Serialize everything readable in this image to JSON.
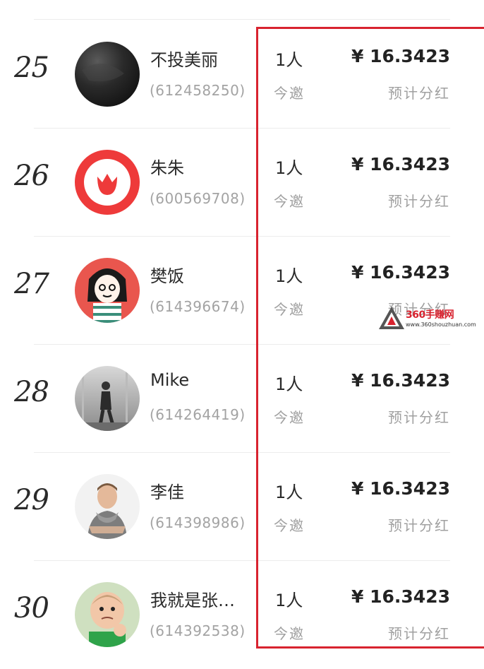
{
  "rows": [
    {
      "rank": "25",
      "name": "不投美丽",
      "uid": "(612458250)",
      "count": "1人",
      "invite_label": "今邀",
      "amount": "¥ 16.3423",
      "dividend_label": "预计分红",
      "avatar": "dark-blur-avatar"
    },
    {
      "rank": "26",
      "name": "朱朱",
      "uid": "(600569708)",
      "count": "1人",
      "invite_label": "今邀",
      "amount": "¥ 16.3423",
      "dividend_label": "预计分红",
      "avatar": "red-tulip-logo-avatar"
    },
    {
      "rank": "27",
      "name": "樊饭",
      "uid": "(614396674)",
      "count": "1人",
      "invite_label": "今邀",
      "amount": "¥ 16.3423",
      "dividend_label": "预计分红",
      "avatar": "cartoon-girl-avatar"
    },
    {
      "rank": "28",
      "name": "Mike",
      "uid": "(614264419)",
      "count": "1人",
      "invite_label": "今邀",
      "amount": "¥ 16.3423",
      "dividend_label": "预计分红",
      "avatar": "walking-man-photo-avatar"
    },
    {
      "rank": "29",
      "name": "李佳",
      "uid": "(614398986)",
      "count": "1人",
      "invite_label": "今邀",
      "amount": "¥ 16.3423",
      "dividend_label": "预计分红",
      "avatar": "man-scarf-photo-avatar"
    },
    {
      "rank": "30",
      "name": "我就是张…",
      "uid": "(614392538)",
      "count": "1人",
      "invite_label": "今邀",
      "amount": "¥ 16.3423",
      "dividend_label": "预计分红",
      "avatar": "baby-fist-photo-avatar"
    }
  ],
  "watermark": {
    "brand": "360手赚网",
    "url": "www.360shouzhuan.com"
  },
  "colors": {
    "highlight": "#d8232f",
    "rank_text": "#2a2a2a",
    "secondary_text": "#a3a3a3"
  }
}
